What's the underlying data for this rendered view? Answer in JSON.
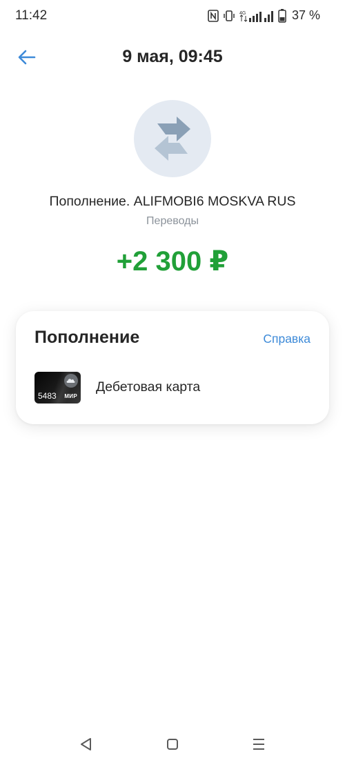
{
  "status_bar": {
    "time": "11:42",
    "battery_percent": "37 %",
    "network_label": "4G"
  },
  "header": {
    "title": "9 мая, 09:45"
  },
  "operation": {
    "title": "Пополнение. ALIFMOBI6 MOSKVA RUS",
    "category": "Переводы",
    "amount": "+2 300 ₽",
    "icon": "transfer-arrows-icon"
  },
  "details": {
    "heading": "Пополнение",
    "help_label": "Справка",
    "account": {
      "name": "Дебетовая карта",
      "card_last_digits": "5483",
      "payment_system": "МИР"
    }
  },
  "colors": {
    "accent": "#3d8ad8",
    "amount_positive": "#21a038",
    "icon_bg": "#e4eaf2",
    "icon_fg": "#8aa0b6"
  }
}
